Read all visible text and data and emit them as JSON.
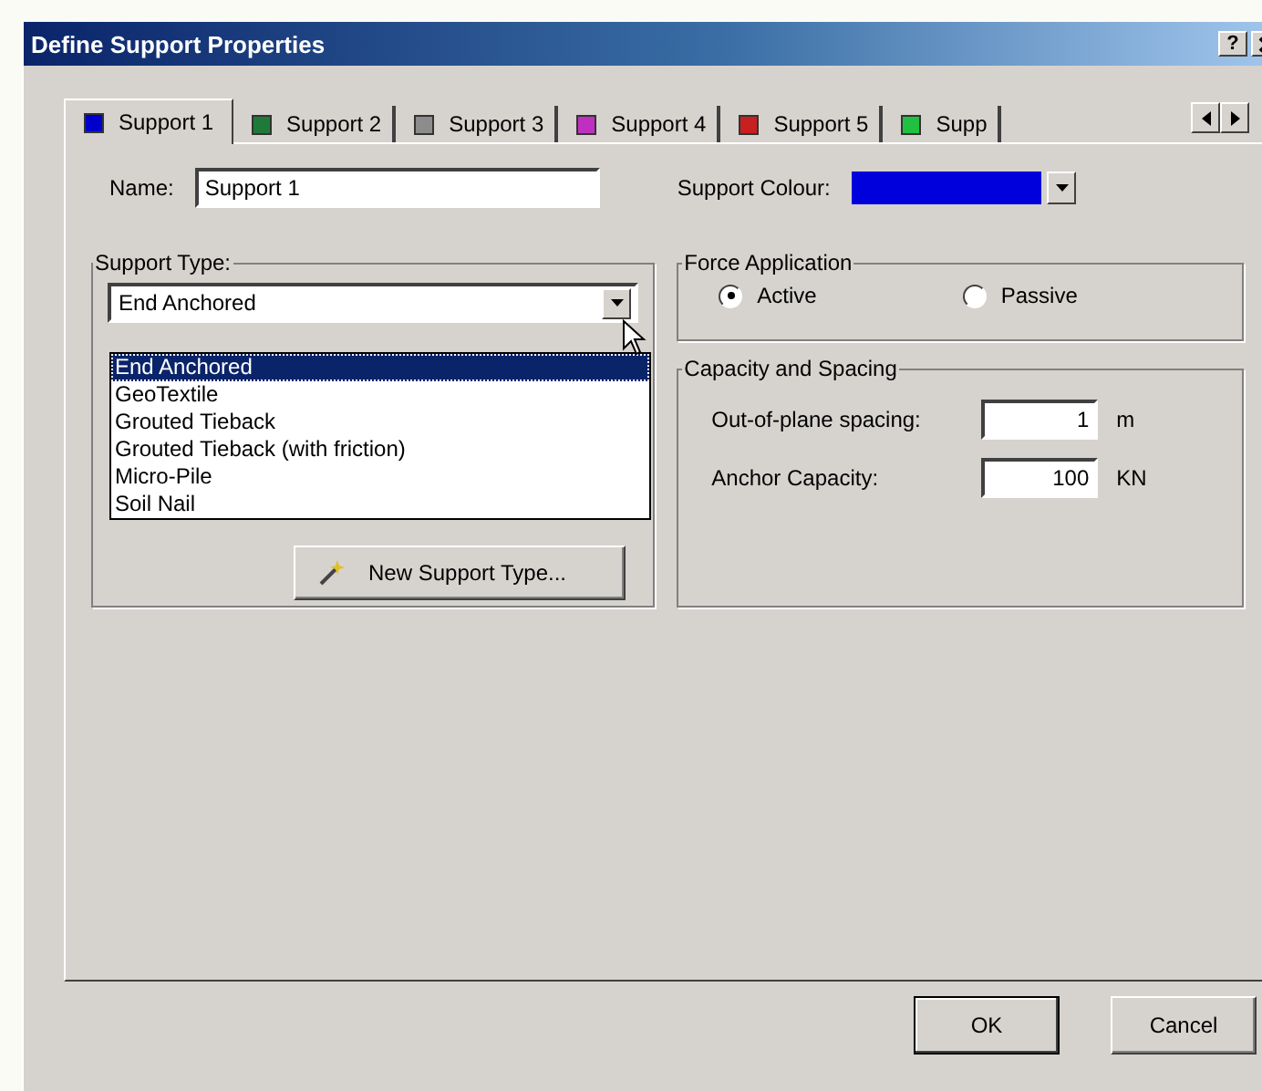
{
  "window": {
    "title": "Define Support Properties",
    "help": "?"
  },
  "tabs": [
    {
      "label": "Support 1",
      "color": "#0000cc",
      "selected": true
    },
    {
      "label": "Support 2",
      "color": "#1f7a3a",
      "selected": false
    },
    {
      "label": "Support 3",
      "color": "#8c8c8c",
      "selected": false
    },
    {
      "label": "Support 4",
      "color": "#c030c0",
      "selected": false
    },
    {
      "label": "Support 5",
      "color": "#c82020",
      "selected": false
    },
    {
      "label": "Supp",
      "color": "#20c040",
      "selected": false
    }
  ],
  "name_field": {
    "label": "Name:",
    "value": "Support 1"
  },
  "support_colour": {
    "label": "Support Colour:",
    "color": "#0000dd"
  },
  "support_type": {
    "title": "Support Type:",
    "value": "End Anchored",
    "expanded": true,
    "options": [
      {
        "label": "End Anchored",
        "selected": true
      },
      {
        "label": "GeoTextile",
        "selected": false
      },
      {
        "label": "Grouted Tieback",
        "selected": false
      },
      {
        "label": "Grouted Tieback (with friction)",
        "selected": false
      },
      {
        "label": "Micro-Pile",
        "selected": false
      },
      {
        "label": "Soil Nail",
        "selected": false
      }
    ],
    "new_button": "New Support Type..."
  },
  "force_application": {
    "title": "Force Application",
    "options": [
      {
        "label": "Active",
        "selected": true
      },
      {
        "label": "Passive",
        "selected": false
      }
    ]
  },
  "capacity": {
    "title": "Capacity and Spacing",
    "fields": [
      {
        "label": "Out-of-plane spacing:",
        "value": "1",
        "unit": "m"
      },
      {
        "label": "Anchor Capacity:",
        "value": "100",
        "unit": "KN"
      }
    ]
  },
  "buttons": [
    {
      "label": "OK",
      "default": true
    },
    {
      "label": "Cancel",
      "default": false
    }
  ]
}
